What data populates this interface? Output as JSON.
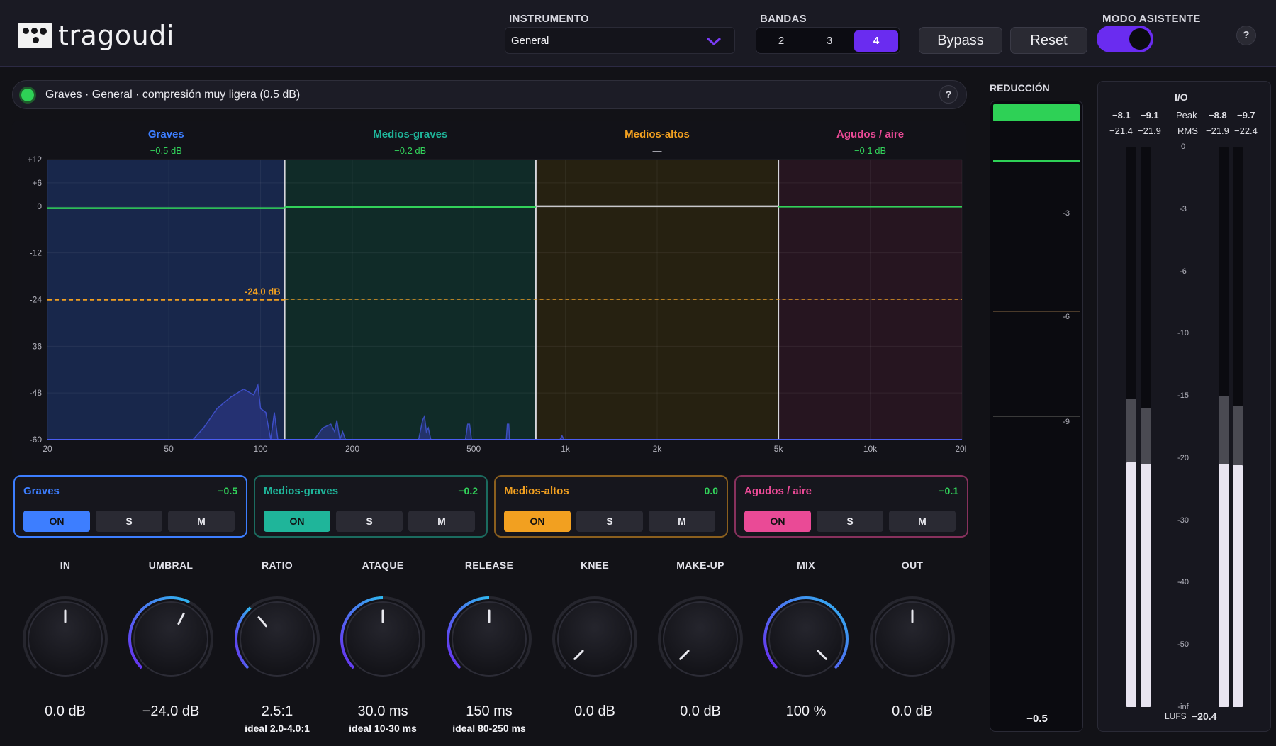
{
  "header": {
    "brand": "tragoudi",
    "instrument_label": "INSTRUMENTO",
    "instrument_value": "General",
    "bands_label": "BANDAS",
    "bands_options": [
      "2",
      "3",
      "4"
    ],
    "bands_selected": "4",
    "bypass_label": "Bypass",
    "reset_label": "Reset",
    "assistant_label": "MODO ASISTENTE",
    "assistant_on": true,
    "help": "?"
  },
  "status": {
    "text": "Graves · General · compresión muy ligera (0.5 dB)",
    "help": "?",
    "led_color": "#2ed156"
  },
  "graph": {
    "bands": [
      {
        "name": "Graves",
        "reduction": "−0.5 dB",
        "color": "#3d7eff"
      },
      {
        "name": "Medios-graves",
        "reduction": "−0.2 dB",
        "color": "#1fb59a"
      },
      {
        "name": "Medios-altos",
        "reduction": "—",
        "color": "#f2a020"
      },
      {
        "name": "Agudos / aire",
        "reduction": "−0.1 dB",
        "color": "#ea4a96"
      }
    ],
    "threshold_label": "-24.0 dB",
    "y_ticks": [
      "+12",
      "+6",
      "0",
      "-12",
      "-24",
      "-36",
      "-48",
      "-60"
    ],
    "x_ticks": [
      "20",
      "50",
      "100",
      "200",
      "500",
      "1k",
      "2k",
      "5k",
      "10k",
      "20k"
    ],
    "crossovers_hz": [
      120,
      800,
      5000
    ]
  },
  "band_cards": [
    {
      "name": "Graves",
      "gr": "−0.5",
      "on": "ON",
      "solo": "S",
      "mute": "M",
      "color": "#3d7eff",
      "selected": true
    },
    {
      "name": "Medios-graves",
      "gr": "−0.2",
      "on": "ON",
      "solo": "S",
      "mute": "M",
      "color": "#1fb59a",
      "selected": false
    },
    {
      "name": "Medios-altos",
      "gr": "0.0",
      "on": "ON",
      "solo": "S",
      "mute": "M",
      "color": "#f2a020",
      "selected": false
    },
    {
      "name": "Agudos / aire",
      "gr": "−0.1",
      "on": "ON",
      "solo": "S",
      "mute": "M",
      "color": "#ea4a96",
      "selected": false
    }
  ],
  "knobs": [
    {
      "label": "IN",
      "value": "0.0 dB",
      "ideal": "",
      "level": 0.5,
      "arc": 0
    },
    {
      "label": "UMBRAL",
      "value": "−24.0 dB",
      "ideal": "",
      "level": 0.6,
      "arc": 0.6
    },
    {
      "label": "RATIO",
      "value": "2.5:1",
      "ideal": "ideal 2.0-4.0:1",
      "level": 0.35,
      "arc": 0.35
    },
    {
      "label": "ATAQUE",
      "value": "30.0 ms",
      "ideal": "ideal 10-30 ms",
      "level": 0.5,
      "arc": 0.5
    },
    {
      "label": "RELEASE",
      "value": "150 ms",
      "ideal": "ideal 80-250 ms",
      "level": 0.5,
      "arc": 0.5
    },
    {
      "label": "KNEE",
      "value": "0.0 dB",
      "ideal": "",
      "level": 0.0,
      "arc": 0
    },
    {
      "label": "MAKE-UP",
      "value": "0.0 dB",
      "ideal": "",
      "level": 0.0,
      "arc": 0
    },
    {
      "label": "MIX",
      "value": "100 %",
      "ideal": "",
      "level": 1.0,
      "arc": 1.0
    },
    {
      "label": "OUT",
      "value": "0.0 dB",
      "ideal": "",
      "level": 0.5,
      "arc": 0
    }
  ],
  "reduction": {
    "label": "REDUCCIÓN",
    "ticks": [
      "-3",
      "-6",
      "-9"
    ],
    "value": "−0.5",
    "level_db": -0.5
  },
  "io": {
    "title": "I/O",
    "peak_in": [
      "−8.1",
      "−9.1"
    ],
    "peak_out": [
      "−8.8",
      "−9.7"
    ],
    "rms_in": [
      "−21.4",
      "−21.9"
    ],
    "rms_out": [
      "−21.9",
      "−22.4"
    ],
    "peak_label": "Peak",
    "rms_label": "RMS",
    "scale": [
      "0",
      "-3",
      "-6",
      "-10",
      "-15",
      "-20",
      "-30",
      "-40",
      "-50",
      "-inf"
    ],
    "lufs_label": "LUFS",
    "lufs_value": "−20.4"
  }
}
